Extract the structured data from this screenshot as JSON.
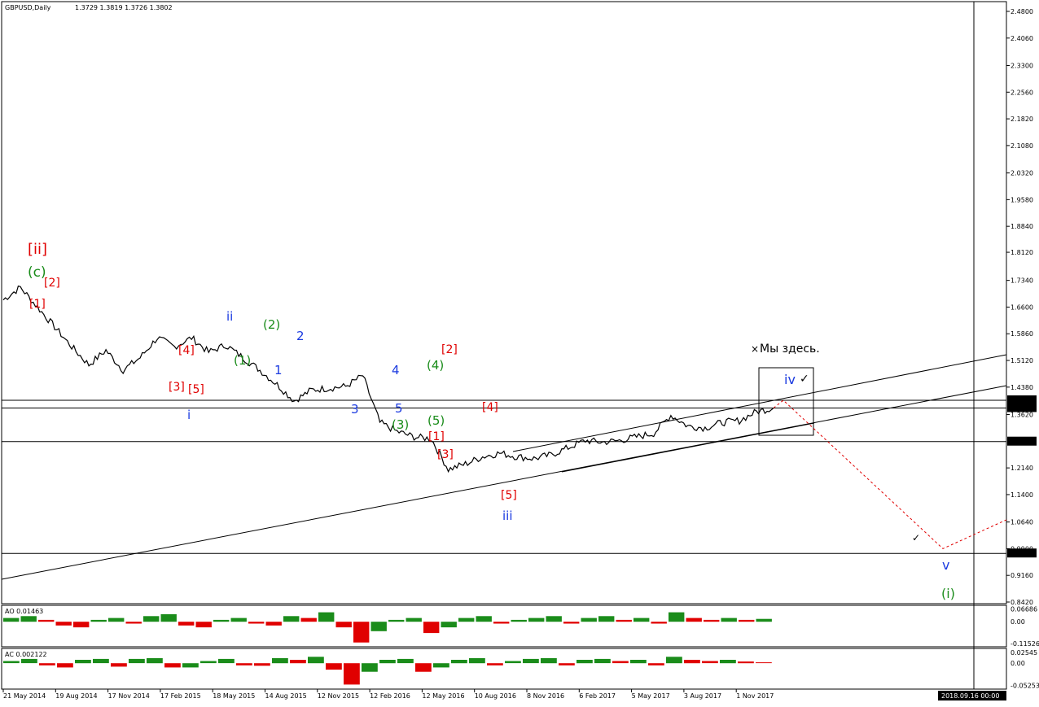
{
  "header": {
    "symbol": "GBPUSD,Daily",
    "ohlc": "1.3729 1.3819 1.3726 1.3802"
  },
  "price_axis": {
    "ticks": [
      "2.4800",
      "2.4060",
      "2.3300",
      "2.2560",
      "2.1820",
      "2.1080",
      "2.0320",
      "1.9580",
      "1.8840",
      "1.8120",
      "1.7340",
      "1.6600",
      "1.5860",
      "1.5120",
      "1.4380",
      "1.3620",
      "1.2140",
      "1.1400",
      "1.0640",
      "0.9900",
      "0.9160",
      "0.8420"
    ],
    "tags": [
      "1.4016",
      "1.3802",
      "1.2871",
      "0.9769"
    ]
  },
  "time_axis": {
    "ticks": [
      "21 May 2014",
      "19 Aug 2014",
      "17 Nov 2014",
      "17 Feb 2015",
      "18 May 2015",
      "14 Aug 2015",
      "12 Nov 2015",
      "12 Feb 2016",
      "12 May 2016",
      "10 Aug 2016",
      "8 Nov 2016",
      "6 Feb 2017",
      "5 May 2017",
      "3 Aug 2017",
      "1 Nov 2017"
    ],
    "cursor_label": "2018.09.16 00:00"
  },
  "ao": {
    "label": "AO 0.01463",
    "ticks": [
      "0.06686",
      "0.00",
      "-0.11526"
    ]
  },
  "ac": {
    "label": "AC 0.002122",
    "ticks": [
      "0.02545",
      "0.00",
      "-0.05253"
    ]
  },
  "annotations": {
    "here_mark": "×",
    "here_text": "Мы здесь.",
    "checkmark": "✓"
  },
  "wave_labels": [
    {
      "text": "[ii]",
      "color": "#e00000"
    },
    {
      "text": "(c)",
      "color": "#1a8c1a"
    },
    {
      "text": "[2]",
      "color": "#e00000"
    },
    {
      "text": "[1]",
      "color": "#e00000"
    },
    {
      "text": "[4]",
      "color": "#e00000"
    },
    {
      "text": "[3]",
      "color": "#e00000"
    },
    {
      "text": "[5]",
      "color": "#e00000"
    },
    {
      "text": "i",
      "color": "#1a3ae0"
    },
    {
      "text": "ii",
      "color": "#1a3ae0"
    },
    {
      "text": "(1)",
      "color": "#1a8c1a"
    },
    {
      "text": "(2)",
      "color": "#1a8c1a"
    },
    {
      "text": "1",
      "color": "#1a3ae0"
    },
    {
      "text": "2",
      "color": "#1a3ae0"
    },
    {
      "text": "3",
      "color": "#1a3ae0"
    },
    {
      "text": "4",
      "color": "#1a3ae0"
    },
    {
      "text": "5",
      "color": "#1a3ae0"
    },
    {
      "text": "(3)",
      "color": "#1a8c1a"
    },
    {
      "text": "(4)",
      "color": "#1a8c1a"
    },
    {
      "text": "(5)",
      "color": "#1a8c1a"
    },
    {
      "text": "[2]",
      "color": "#e00000"
    },
    {
      "text": "[1]",
      "color": "#e00000"
    },
    {
      "text": "[3]",
      "color": "#e00000"
    },
    {
      "text": "[4]",
      "color": "#e00000"
    },
    {
      "text": "[5]",
      "color": "#e00000"
    },
    {
      "text": "iii",
      "color": "#1a3ae0"
    },
    {
      "text": "iv",
      "color": "#1a3ae0"
    },
    {
      "text": "v",
      "color": "#1a3ae0"
    },
    {
      "text": "(i)",
      "color": "#1a8c1a"
    }
  ],
  "chart_data": {
    "type": "line",
    "title": "GBPUSD,Daily",
    "ylim": [
      0.842,
      2.48
    ],
    "x": [
      "21 May 2014",
      "19 Aug 2014",
      "17 Nov 2014",
      "17 Feb 2015",
      "18 May 2015",
      "14 Aug 2015",
      "12 Nov 2015",
      "12 Feb 2016",
      "12 May 2016",
      "10 Aug 2016",
      "8 Nov 2016",
      "6 Feb 2017",
      "5 May 2017",
      "3 Aug 2017",
      "1 Nov 2017"
    ],
    "series": [
      {
        "values": [
          1.68,
          1.715,
          1.66,
          1.605,
          1.55,
          1.5,
          1.54,
          1.485,
          1.52,
          1.575,
          1.55,
          1.575,
          1.535,
          1.555,
          1.52,
          1.485,
          1.445,
          1.4,
          1.43,
          1.435,
          1.44,
          1.47,
          1.34,
          1.315,
          1.3,
          1.295,
          1.21,
          1.225,
          1.245,
          1.255,
          1.245,
          1.24,
          1.25,
          1.27,
          1.29,
          1.285,
          1.29,
          1.3,
          1.31,
          1.36,
          1.33,
          1.325,
          1.34,
          1.345,
          1.37,
          1.38
        ]
      }
    ],
    "projection": {
      "values": [
        1.38,
        1.4016,
        0.99,
        1.07
      ],
      "color": "#e00000"
    },
    "horizontal_levels": [
      1.4016,
      1.3802,
      1.2871,
      0.9769
    ],
    "colors": {
      "up": "#1a8c1a",
      "down": "#e00000",
      "price": "#000000"
    },
    "ao_values": [
      0.02,
      0.03,
      0.01,
      -0.02,
      -0.03,
      0.01,
      0.02,
      -0.01,
      0.03,
      0.04,
      -0.02,
      -0.03,
      0.01,
      0.02,
      -0.01,
      -0.02,
      0.03,
      0.02,
      0.05,
      -0.03,
      -0.11,
      -0.05,
      0.01,
      0.02,
      -0.06,
      -0.03,
      0.02,
      0.03,
      -0.01,
      0.01,
      0.02,
      0.03,
      -0.01,
      0.02,
      0.03,
      0.01,
      0.02,
      -0.01,
      0.05,
      0.02,
      0.01,
      0.02,
      0.01,
      0.015
    ],
    "ac_values": [
      0.005,
      0.01,
      -0.005,
      -0.01,
      0.008,
      0.01,
      -0.008,
      0.01,
      0.012,
      -0.01,
      -0.01,
      0.005,
      0.01,
      -0.005,
      -0.006,
      0.012,
      0.008,
      0.015,
      -0.015,
      -0.05,
      -0.02,
      0.008,
      0.01,
      -0.02,
      -0.01,
      0.008,
      0.012,
      -0.005,
      0.005,
      0.01,
      0.012,
      -0.005,
      0.008,
      0.01,
      0.005,
      0.008,
      -0.005,
      0.015,
      0.008,
      0.005,
      0.008,
      0.004,
      0.002
    ]
  }
}
